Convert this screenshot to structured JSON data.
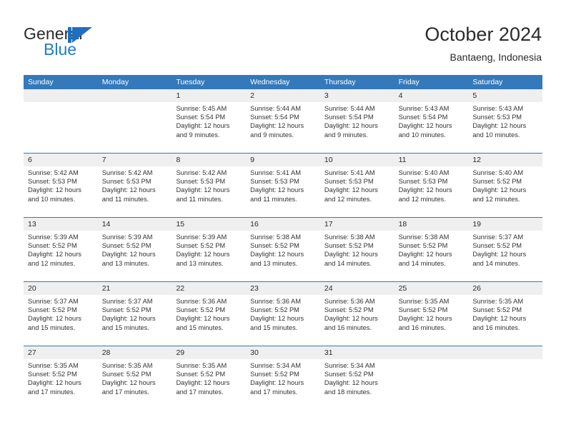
{
  "brand": {
    "name_part1": "General",
    "name_part2": "Blue",
    "logo_icon": "triangle-flag-icon"
  },
  "header": {
    "title": "October 2024",
    "subtitle": "Bantaeng, Indonesia"
  },
  "colors": {
    "header_blue": "#3379bb",
    "brand_blue": "#1f7dc4",
    "daynum_band": "#efefef",
    "text": "#333333"
  },
  "weekday_headers": [
    "Sunday",
    "Monday",
    "Tuesday",
    "Wednesday",
    "Thursday",
    "Friday",
    "Saturday"
  ],
  "weeks": [
    [
      {
        "day": "",
        "lines": []
      },
      {
        "day": "",
        "lines": []
      },
      {
        "day": "1",
        "lines": [
          "Sunrise: 5:45 AM",
          "Sunset: 5:54 PM",
          "Daylight: 12 hours",
          "and 9 minutes."
        ]
      },
      {
        "day": "2",
        "lines": [
          "Sunrise: 5:44 AM",
          "Sunset: 5:54 PM",
          "Daylight: 12 hours",
          "and 9 minutes."
        ]
      },
      {
        "day": "3",
        "lines": [
          "Sunrise: 5:44 AM",
          "Sunset: 5:54 PM",
          "Daylight: 12 hours",
          "and 9 minutes."
        ]
      },
      {
        "day": "4",
        "lines": [
          "Sunrise: 5:43 AM",
          "Sunset: 5:54 PM",
          "Daylight: 12 hours",
          "and 10 minutes."
        ]
      },
      {
        "day": "5",
        "lines": [
          "Sunrise: 5:43 AM",
          "Sunset: 5:53 PM",
          "Daylight: 12 hours",
          "and 10 minutes."
        ]
      }
    ],
    [
      {
        "day": "6",
        "lines": [
          "Sunrise: 5:42 AM",
          "Sunset: 5:53 PM",
          "Daylight: 12 hours",
          "and 10 minutes."
        ]
      },
      {
        "day": "7",
        "lines": [
          "Sunrise: 5:42 AM",
          "Sunset: 5:53 PM",
          "Daylight: 12 hours",
          "and 11 minutes."
        ]
      },
      {
        "day": "8",
        "lines": [
          "Sunrise: 5:42 AM",
          "Sunset: 5:53 PM",
          "Daylight: 12 hours",
          "and 11 minutes."
        ]
      },
      {
        "day": "9",
        "lines": [
          "Sunrise: 5:41 AM",
          "Sunset: 5:53 PM",
          "Daylight: 12 hours",
          "and 11 minutes."
        ]
      },
      {
        "day": "10",
        "lines": [
          "Sunrise: 5:41 AM",
          "Sunset: 5:53 PM",
          "Daylight: 12 hours",
          "and 12 minutes."
        ]
      },
      {
        "day": "11",
        "lines": [
          "Sunrise: 5:40 AM",
          "Sunset: 5:53 PM",
          "Daylight: 12 hours",
          "and 12 minutes."
        ]
      },
      {
        "day": "12",
        "lines": [
          "Sunrise: 5:40 AM",
          "Sunset: 5:52 PM",
          "Daylight: 12 hours",
          "and 12 minutes."
        ]
      }
    ],
    [
      {
        "day": "13",
        "lines": [
          "Sunrise: 5:39 AM",
          "Sunset: 5:52 PM",
          "Daylight: 12 hours",
          "and 12 minutes."
        ]
      },
      {
        "day": "14",
        "lines": [
          "Sunrise: 5:39 AM",
          "Sunset: 5:52 PM",
          "Daylight: 12 hours",
          "and 13 minutes."
        ]
      },
      {
        "day": "15",
        "lines": [
          "Sunrise: 5:39 AM",
          "Sunset: 5:52 PM",
          "Daylight: 12 hours",
          "and 13 minutes."
        ]
      },
      {
        "day": "16",
        "lines": [
          "Sunrise: 5:38 AM",
          "Sunset: 5:52 PM",
          "Daylight: 12 hours",
          "and 13 minutes."
        ]
      },
      {
        "day": "17",
        "lines": [
          "Sunrise: 5:38 AM",
          "Sunset: 5:52 PM",
          "Daylight: 12 hours",
          "and 14 minutes."
        ]
      },
      {
        "day": "18",
        "lines": [
          "Sunrise: 5:38 AM",
          "Sunset: 5:52 PM",
          "Daylight: 12 hours",
          "and 14 minutes."
        ]
      },
      {
        "day": "19",
        "lines": [
          "Sunrise: 5:37 AM",
          "Sunset: 5:52 PM",
          "Daylight: 12 hours",
          "and 14 minutes."
        ]
      }
    ],
    [
      {
        "day": "20",
        "lines": [
          "Sunrise: 5:37 AM",
          "Sunset: 5:52 PM",
          "Daylight: 12 hours",
          "and 15 minutes."
        ]
      },
      {
        "day": "21",
        "lines": [
          "Sunrise: 5:37 AM",
          "Sunset: 5:52 PM",
          "Daylight: 12 hours",
          "and 15 minutes."
        ]
      },
      {
        "day": "22",
        "lines": [
          "Sunrise: 5:36 AM",
          "Sunset: 5:52 PM",
          "Daylight: 12 hours",
          "and 15 minutes."
        ]
      },
      {
        "day": "23",
        "lines": [
          "Sunrise: 5:36 AM",
          "Sunset: 5:52 PM",
          "Daylight: 12 hours",
          "and 15 minutes."
        ]
      },
      {
        "day": "24",
        "lines": [
          "Sunrise: 5:36 AM",
          "Sunset: 5:52 PM",
          "Daylight: 12 hours",
          "and 16 minutes."
        ]
      },
      {
        "day": "25",
        "lines": [
          "Sunrise: 5:35 AM",
          "Sunset: 5:52 PM",
          "Daylight: 12 hours",
          "and 16 minutes."
        ]
      },
      {
        "day": "26",
        "lines": [
          "Sunrise: 5:35 AM",
          "Sunset: 5:52 PM",
          "Daylight: 12 hours",
          "and 16 minutes."
        ]
      }
    ],
    [
      {
        "day": "27",
        "lines": [
          "Sunrise: 5:35 AM",
          "Sunset: 5:52 PM",
          "Daylight: 12 hours",
          "and 17 minutes."
        ]
      },
      {
        "day": "28",
        "lines": [
          "Sunrise: 5:35 AM",
          "Sunset: 5:52 PM",
          "Daylight: 12 hours",
          "and 17 minutes."
        ]
      },
      {
        "day": "29",
        "lines": [
          "Sunrise: 5:35 AM",
          "Sunset: 5:52 PM",
          "Daylight: 12 hours",
          "and 17 minutes."
        ]
      },
      {
        "day": "30",
        "lines": [
          "Sunrise: 5:34 AM",
          "Sunset: 5:52 PM",
          "Daylight: 12 hours",
          "and 17 minutes."
        ]
      },
      {
        "day": "31",
        "lines": [
          "Sunrise: 5:34 AM",
          "Sunset: 5:52 PM",
          "Daylight: 12 hours",
          "and 18 minutes."
        ]
      },
      {
        "day": "",
        "lines": []
      },
      {
        "day": "",
        "lines": []
      }
    ]
  ]
}
